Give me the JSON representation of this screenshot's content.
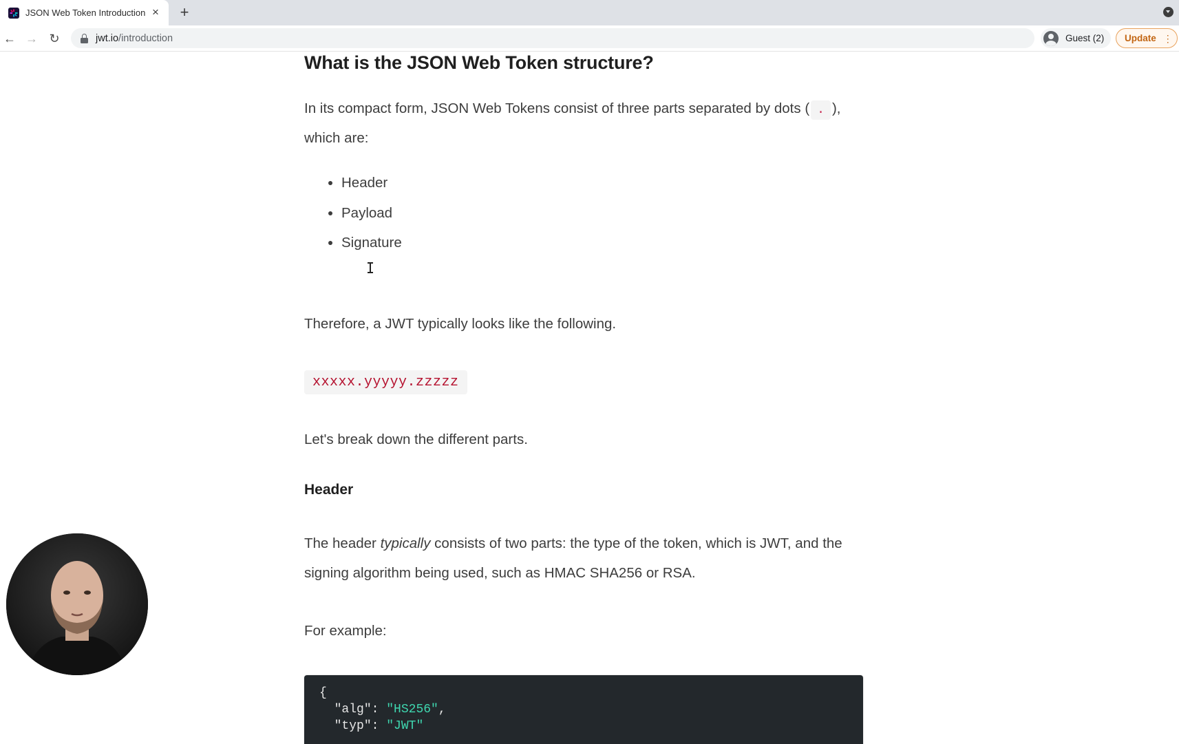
{
  "browser": {
    "tab_title": "JSON Web Token Introduction",
    "url_host": "jwt.io",
    "url_path": "/introduction",
    "profile_label": "Guest (2)",
    "update_label": "Update"
  },
  "article": {
    "heading": "What is the JSON Web Token structure?",
    "intro_before": "In its compact form, JSON Web Tokens consist of three parts separated by dots (",
    "intro_code": ".",
    "intro_after": "), which are:",
    "parts": [
      "Header",
      "Payload",
      "Signature"
    ],
    "therefore": "Therefore, a JWT typically looks like the following.",
    "example_token": "xxxxx.yyyyy.zzzzz",
    "break_down": "Let's break down the different parts.",
    "header_heading": "Header",
    "header_desc_before": "The header ",
    "header_desc_em": "typically",
    "header_desc_after": " consists of two parts: the type of the token, which is JWT, and the signing algorithm being used, such as HMAC SHA256 or RSA.",
    "for_example": "For example:",
    "code": {
      "open_brace": "{",
      "alg_key": "\"alg\"",
      "alg_value": "\"HS256\"",
      "typ_key": "\"typ\"",
      "typ_value": "\"JWT\""
    }
  },
  "icons": {
    "favicon": "jwt-logo-icon",
    "back": "arrow-left-icon",
    "forward": "arrow-right-icon",
    "reload": "reload-icon",
    "lock": "lock-icon",
    "profile": "avatar-icon",
    "menu": "kebab-icon"
  }
}
